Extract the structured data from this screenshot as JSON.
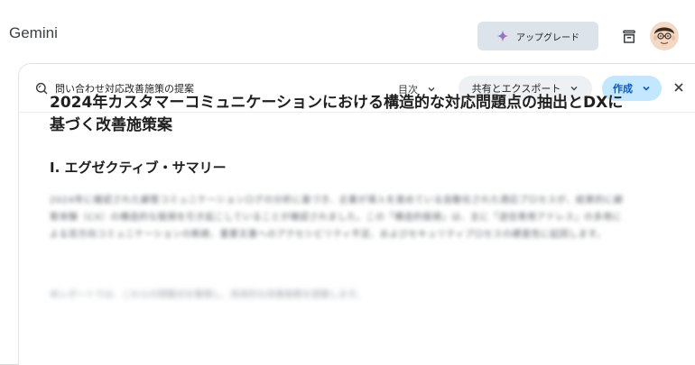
{
  "app": {
    "title": "Gemini"
  },
  "header": {
    "upgrade_label": "アップグレード",
    "accent_gradient": [
      "#4285f4",
      "#9b72cb",
      "#d96570"
    ]
  },
  "panel": {
    "doc_title": "問い合わせ対応改善施策の提案",
    "toc_label": "目次",
    "share_label": "共有とエクスポート",
    "create_label": "作成",
    "create_color": "#c2e7ff"
  },
  "document": {
    "title": "2024年カスタマーコミュニケーションにおける構造的な対応問題点の抽出とDXに基づく改善施策案",
    "section_heading": "I. エグゼクティブ・サマリー",
    "blurred_paragraph": "2024年に確認された顧客コミュニケーションログの分析に基づき、企業が導入を進めている自動化された適応プロセスが、結果的に顧客体験（CX）の構造的な毀損を引き起こしていることが確認されました。この「構造的毀損」は、主に「送信専用アドレス」の多用による双方向コミュニケーションの断絶、重要文書へのアクセシビリティ不足、およびセキュリティプロセスの硬直性に起因します。",
    "blurred_tail": "本レポートでは、これらの問題点を整理し、具体的な改善施策を提案します。"
  }
}
